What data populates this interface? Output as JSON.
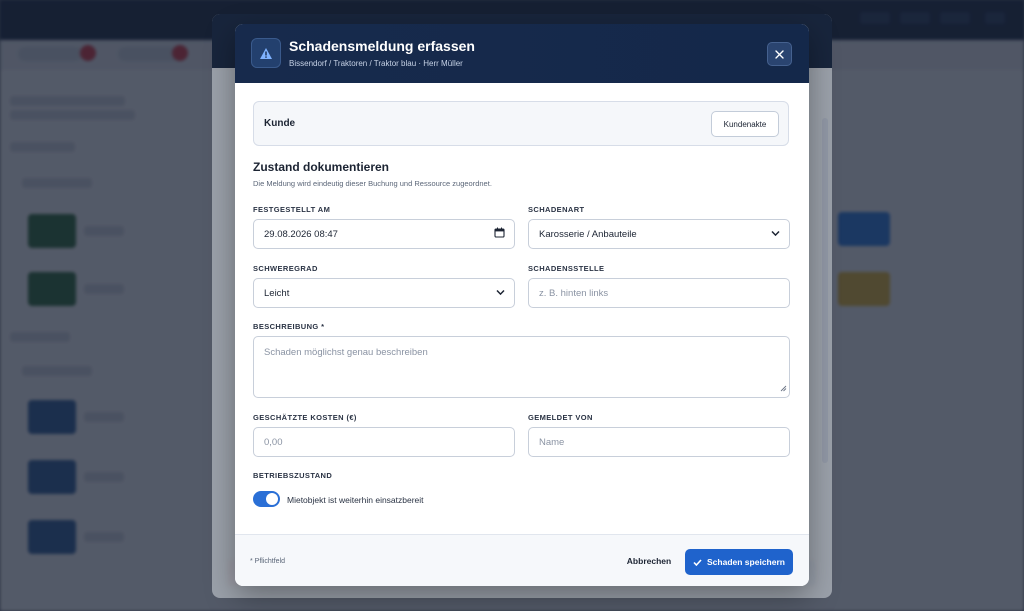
{
  "modal": {
    "title": "Schadensmeldung erfassen",
    "subtitle": "Bissendorf / Traktoren / Traktor blau · Herr Müller",
    "close_icon": "close-icon",
    "header_icon": "warning-icon"
  },
  "customer": {
    "label": "Kunde",
    "button_label": "Kundenakte"
  },
  "section": {
    "title": "Zustand dokumentieren",
    "description": "Die Meldung wird eindeutig dieser Buchung und Ressource zugeordnet."
  },
  "fields": {
    "detected_at": {
      "label": "FESTGESTELLT AM",
      "value": "29.08.2026 08:47"
    },
    "damage_type": {
      "label": "SCHADENART",
      "value": "Karosserie / Anbauteile"
    },
    "severity": {
      "label": "SCHWEREGRAD",
      "value": "Leicht"
    },
    "damage_location": {
      "label": "SCHADENSSTELLE",
      "placeholder": "z. B. hinten links"
    },
    "description": {
      "label": "BESCHREIBUNG *",
      "placeholder": "Schaden möglichst genau beschreiben"
    },
    "estimated_cost": {
      "label": "GESCHÄTZTE KOSTEN (€)",
      "placeholder": "0,00"
    },
    "reported_by": {
      "label": "GEMELDET VON",
      "placeholder": "Name"
    },
    "operational_status": {
      "label": "BETRIEBSZUSTAND",
      "toggle_label": "Mietobjekt ist weiterhin einsatzbereit",
      "enabled": true
    }
  },
  "footer": {
    "note": "* Pflichtfeld",
    "cancel_label": "Abbrechen",
    "save_label": "Schaden speichern"
  },
  "colors": {
    "header_bg": "#172a4c",
    "primary": "#1f63cc",
    "toggle_on": "#2a6fd6"
  }
}
